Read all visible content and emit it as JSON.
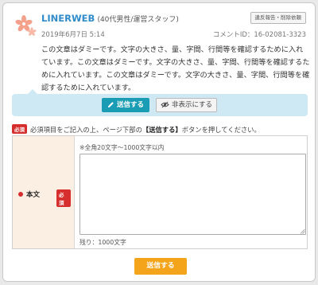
{
  "comment": {
    "author_name": "LINERWEB",
    "author_meta": "(40代男性/運営スタッフ)",
    "report_button_label": "違反報告・削除依頼",
    "date": "2019年6月7日 5:14",
    "comment_id": "コメントID：16-02081-3323",
    "body": "この文章はダミーです。文字の大きさ、量、字間、行間等を確認するために入れています。この文章はダミーです。文字の大きさ、量、字間、行間等を確認するために入れています。この文章はダミーです。文字の大きさ、量、字間、行間等を確認するために入れています。",
    "avatar_icon": "flower-icon",
    "avatar_color": "#f4a08a"
  },
  "actions": {
    "send_label": "送信する",
    "hide_label": "非表示にする",
    "send_icon": "pencil-icon",
    "hide_icon": "eye-slash-icon"
  },
  "form": {
    "required_badge": "必須",
    "note_before": "必須項目をご記入の上、ページ下部の",
    "note_bold": "【送信する】",
    "note_after": "ボタンを押してください。",
    "field_label": "本文",
    "field_hint": "※全角20文字〜1000文字以内",
    "textarea_value": "",
    "remaining": "残り：1000文字"
  },
  "submit": {
    "label": "送信する"
  },
  "colors": {
    "accent_blue": "#1a9cb5",
    "submit_orange": "#f3a41b",
    "required_red": "#d62d2d",
    "label_bg": "#fbefe4",
    "action_bar_bg": "#cfe9f4"
  }
}
